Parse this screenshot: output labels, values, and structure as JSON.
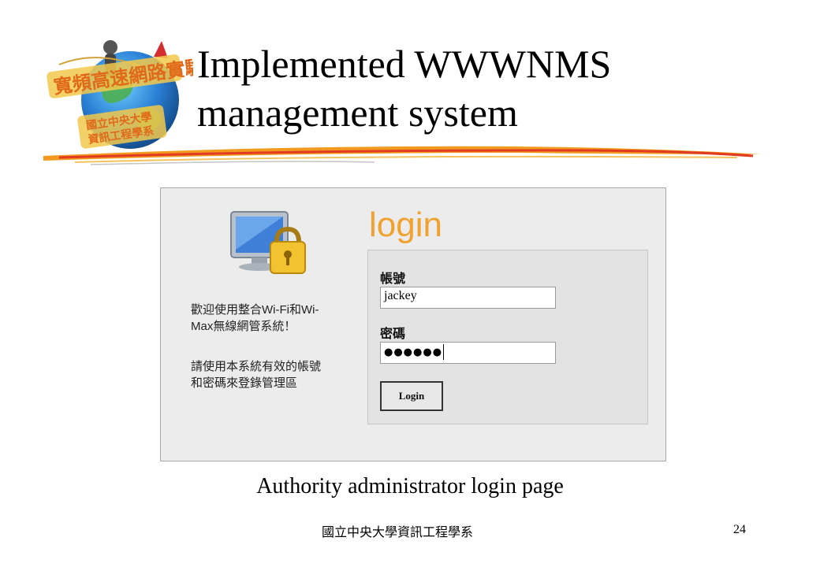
{
  "slide": {
    "title_line1": "Implemented WWWNMS",
    "title_line2": "management system",
    "caption": "Authority administrator login page",
    "footer": "國立中央大學資訊工程學系",
    "page_number": "24"
  },
  "logo": {
    "top_text": "寬頻高速網路實驗",
    "bottom_text_line1": "國立中央大學",
    "bottom_text_line2": "資訊工程學系",
    "icon": "globe-logo"
  },
  "login": {
    "heading": "login",
    "welcome_line1": "歡迎使用整合Wi-Fi和Wi-",
    "welcome_line2": "Max無線網管系統！",
    "instruction_line1": "請使用本系統有效的帳號",
    "instruction_line2": "和密碼來登錄管理區",
    "account_label": "帳號",
    "account_value": "jackey",
    "password_label": "密碼",
    "password_value": "●●●●●●",
    "button_label": "Login",
    "icon": "monitor-lock-icon"
  },
  "colors": {
    "login_heading": "#f0a130",
    "panel_bg": "#ececec",
    "form_bg": "#e3e3e3"
  }
}
